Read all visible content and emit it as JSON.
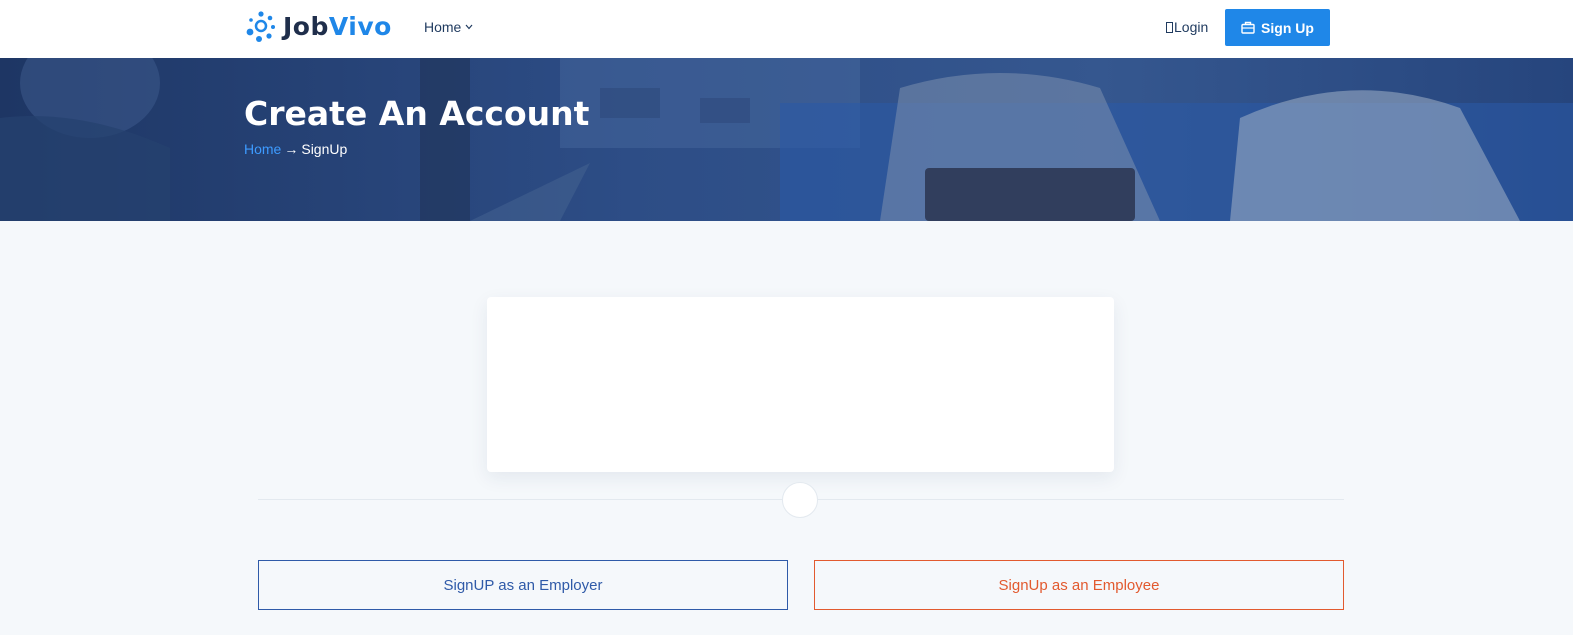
{
  "header": {
    "logo": {
      "part1": "Job",
      "part2": "Vivo"
    },
    "nav_home": "Home",
    "login_label": "Login",
    "signup_label": "Sign Up"
  },
  "hero": {
    "title": "Create An Account",
    "breadcrumb_home": "Home",
    "breadcrumb_arrow": "→",
    "breadcrumb_current": "SignUp"
  },
  "actions": {
    "employer_label": "SignUP as an Employer",
    "employee_label": "SignUp as an Employee"
  },
  "colors": {
    "accent": "#1f87e8",
    "employer": "#2f5aa8",
    "employee": "#e25a2f",
    "hero_overlay": "#213f76"
  },
  "icons": [
    "logo-dots-icon",
    "chevron-down-icon",
    "login-icon",
    "briefcase-icon",
    "arrow-right-icon"
  ]
}
